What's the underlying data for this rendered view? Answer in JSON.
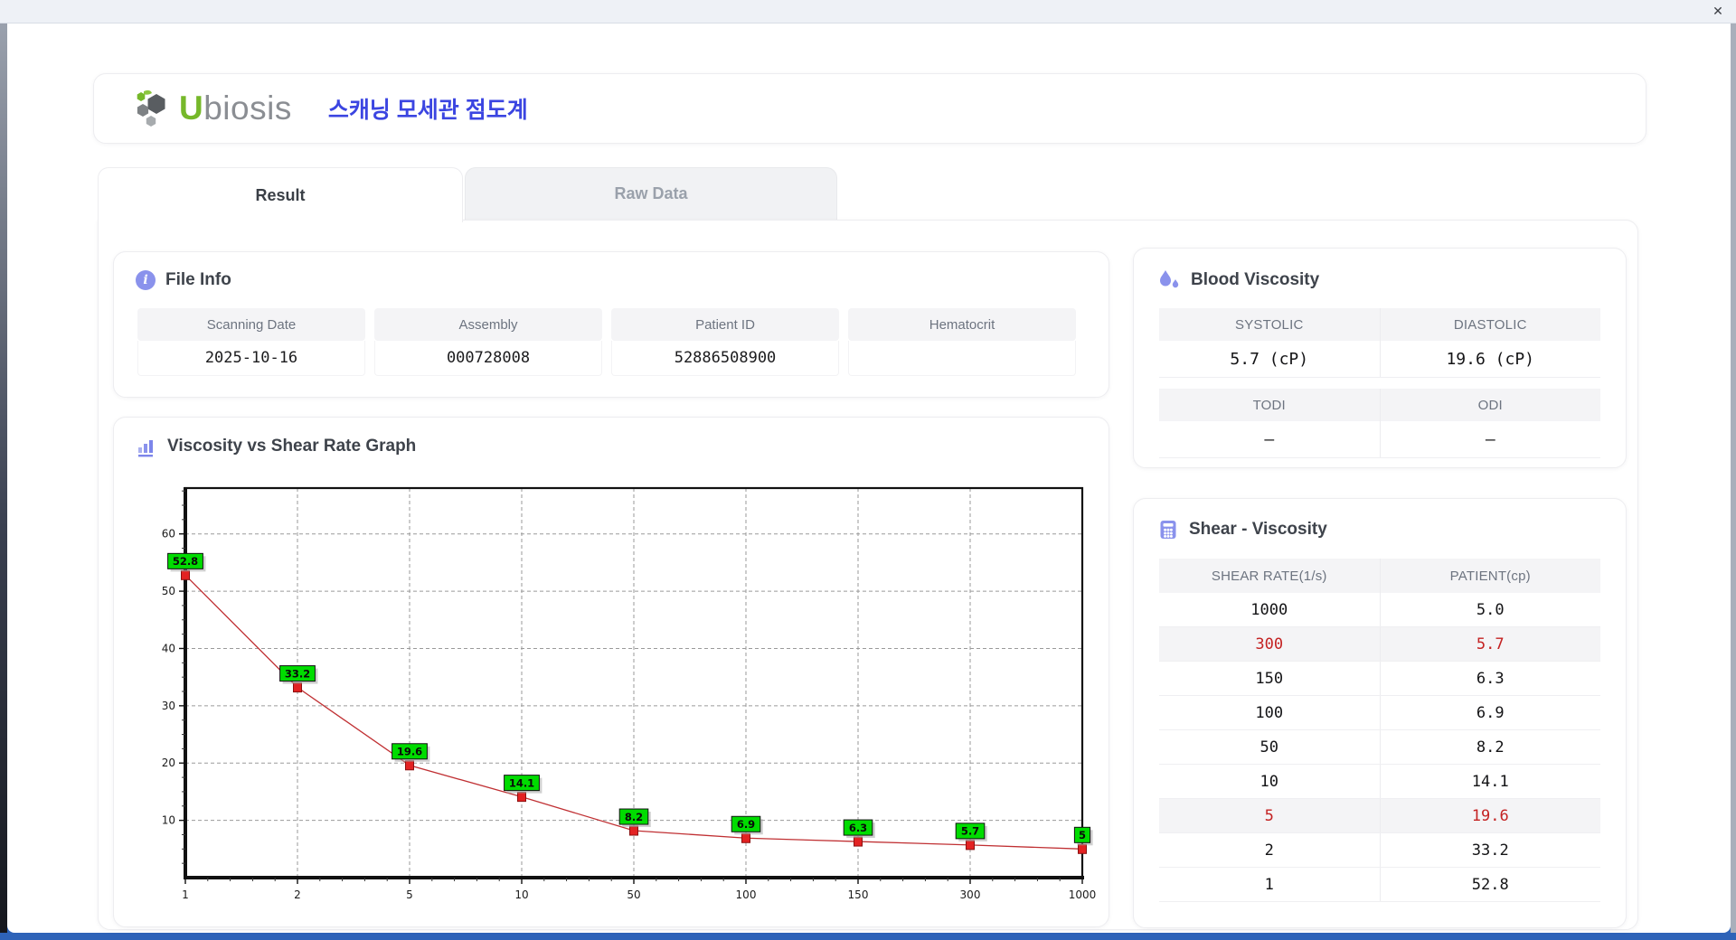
{
  "window": {
    "close_label": "✕"
  },
  "header": {
    "logo_u": "U",
    "logo_rest": "biosis",
    "app_title_korean": "스캐닝 모세관 점도계"
  },
  "tabs": [
    {
      "label": "Result",
      "active": true
    },
    {
      "label": "Raw Data",
      "active": false
    }
  ],
  "file_info": {
    "title": "File Info",
    "fields": [
      {
        "label": "Scanning Date",
        "value": "2025-10-16"
      },
      {
        "label": "Assembly",
        "value": "000728008"
      },
      {
        "label": "Patient ID",
        "value": "52886508900"
      },
      {
        "label": "Hematocrit",
        "value": ""
      }
    ]
  },
  "graph_section": {
    "title": "Viscosity vs Shear Rate Graph"
  },
  "chart_data": {
    "type": "line",
    "title": "Viscosity vs Shear Rate Graph",
    "x_categories": [
      1,
      2,
      5,
      10,
      50,
      100,
      150,
      300,
      1000
    ],
    "series": [
      {
        "name": "PATIENT(cp)",
        "values": [
          52.8,
          33.2,
          19.6,
          14.1,
          8.2,
          6.9,
          6.3,
          5.7,
          5.0
        ]
      }
    ],
    "point_labels": [
      "52.8",
      "33.2",
      "19.6",
      "14.1",
      "8.2",
      "6.9",
      "6.3",
      "5.7",
      "5"
    ],
    "y_ticks": [
      10,
      20,
      30,
      40,
      50,
      60
    ],
    "ylim": [
      0,
      68
    ],
    "x_scale": "categorical",
    "grid": "dashed",
    "legend": "none",
    "xlabel": "",
    "ylabel": "",
    "style": {
      "line_color": "#c03033",
      "marker_fill": "#e32222",
      "marker_stroke": "#8b1010",
      "label_bg": "#00dc00",
      "label_border": "#111111",
      "label_shadow": "#aaaaaa",
      "grid_color": "#9a9a9a",
      "axis_color": "#111111"
    }
  },
  "blood_viscosity": {
    "title": "Blood Viscosity",
    "rows": [
      {
        "label": "SYSTOLIC",
        "value": "5.7 (cP)"
      },
      {
        "label": "DIASTOLIC",
        "value": "19.6 (cP)"
      },
      {
        "label": "TODI",
        "value": "–"
      },
      {
        "label": "ODI",
        "value": "–"
      }
    ]
  },
  "shear_viscosity": {
    "title": "Shear - Viscosity",
    "columns": [
      "SHEAR RATE(1/s)",
      "PATIENT(cp)"
    ],
    "rows": [
      {
        "shear_rate": "1000",
        "patient": "5.0",
        "highlight": false
      },
      {
        "shear_rate": "300",
        "patient": "5.7",
        "highlight": true
      },
      {
        "shear_rate": "150",
        "patient": "6.3",
        "highlight": false
      },
      {
        "shear_rate": "100",
        "patient": "6.9",
        "highlight": false
      },
      {
        "shear_rate": "50",
        "patient": "8.2",
        "highlight": false
      },
      {
        "shear_rate": "10",
        "patient": "14.1",
        "highlight": false
      },
      {
        "shear_rate": "5",
        "patient": "19.6",
        "highlight": true
      },
      {
        "shear_rate": "2",
        "patient": "33.2",
        "highlight": false
      },
      {
        "shear_rate": "1",
        "patient": "52.8",
        "highlight": false
      }
    ]
  },
  "colors": {
    "accent_blue": "#3b45e1",
    "icon_purple": "#8a92ec",
    "brand_green": "#76b82a",
    "highlight_red": "#c42222"
  }
}
